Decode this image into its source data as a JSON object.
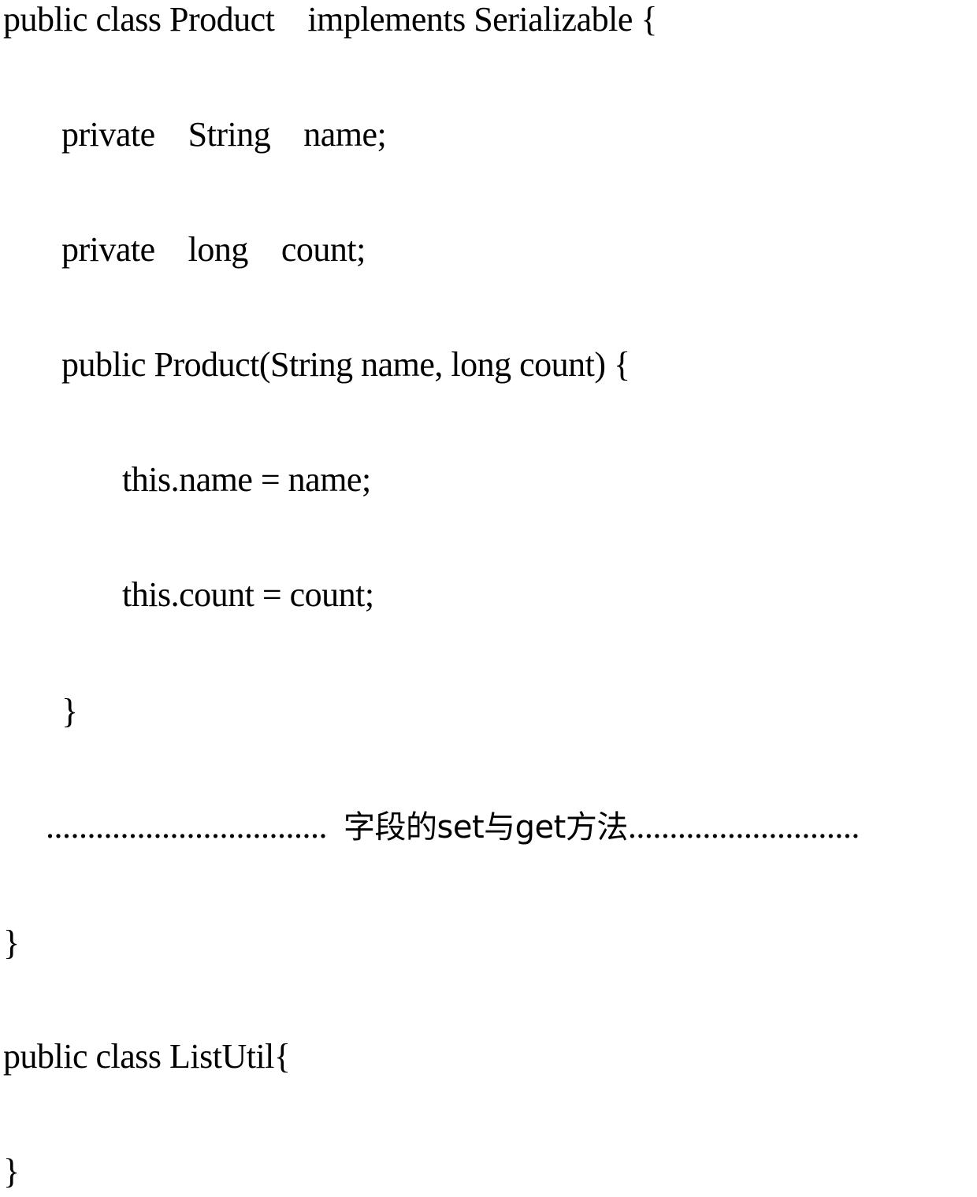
{
  "document": {
    "lines": [
      "public class Product    implements Serializable {",
      "private    String    name;",
      "private    long    count;",
      "public Product(String name, long count) {",
      "this.name = name;",
      "this.count = count;",
      "}",
      "}",
      "public class ListUtil{",
      "}"
    ],
    "comment_line": {
      "leading_dots": "..................................",
      "text": "字段的set与get方法",
      "trailing_dots": "............................"
    }
  }
}
